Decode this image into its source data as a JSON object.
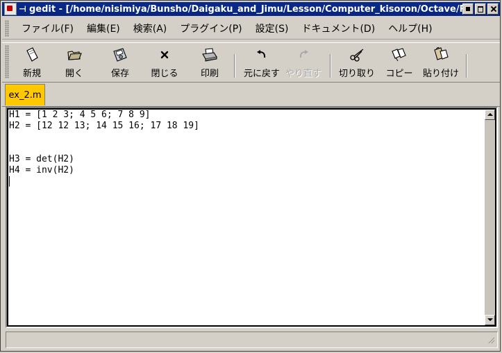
{
  "window": {
    "title": "gedit - [/home/nisimiya/Bunsho/Daigaku_and_Jimu/Lesson/Computer_kisoron/Octave/Re",
    "title_prefix_glyph": "⊣",
    "colors": {
      "titlebar": "#082580",
      "tab_active": "#ffc800"
    }
  },
  "menubar": {
    "items": [
      "ファイル(F)",
      "編集(E)",
      "検索(A)",
      "プラグイン(P)",
      "設定(S)",
      "ドキュメント(D)",
      "ヘルプ(H)"
    ]
  },
  "toolbar": {
    "new": {
      "label": "新規",
      "icon": "new-document-icon"
    },
    "open": {
      "label": "開く",
      "icon": "open-folder-icon"
    },
    "save": {
      "label": "保存",
      "icon": "save-disk-icon"
    },
    "close": {
      "label": "閉じる",
      "icon": "close-x-icon"
    },
    "print": {
      "label": "印刷",
      "icon": "printer-icon"
    },
    "undo": {
      "label": "元に戻す",
      "icon": "undo-arrow-icon"
    },
    "redo": {
      "label": "やり直す",
      "icon": "redo-arrow-icon",
      "disabled": true
    },
    "cut": {
      "label": "切り取り",
      "icon": "scissors-icon"
    },
    "copy": {
      "label": "コピー",
      "icon": "copy-icon"
    },
    "paste": {
      "label": "貼り付け",
      "icon": "paste-icon"
    }
  },
  "tabs": [
    {
      "label": "ex_2.m",
      "active": true
    }
  ],
  "editor": {
    "lines": [
      "H1 = [1 2 3; 4 5 6; 7 8 9]",
      "H2 = [12 12 13; 14 15 16; 17 18 19]",
      "",
      "",
      "H3 = det(H2)",
      "H4 = inv(H2)"
    ]
  },
  "statusbar": {
    "text": ""
  }
}
